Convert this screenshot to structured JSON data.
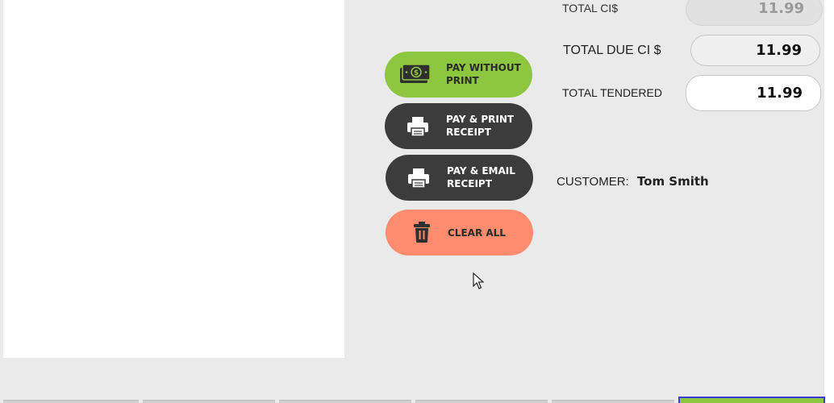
{
  "payment_buttons": {
    "pay_without_print": {
      "label": "PAY WITHOUT\nPRINT",
      "icon": "cash-icon"
    },
    "pay_print": {
      "label": "PAY & PRINT\nRECEIPT",
      "icon": "printer-icon"
    },
    "pay_email": {
      "label": "PAY & EMAIL\nRECEIPT",
      "icon": "printer-icon"
    },
    "clear_all": {
      "label": "CLEAR ALL",
      "icon": "trash-icon"
    }
  },
  "totals": {
    "total_ci": {
      "label": "TOTAL CI$",
      "value": "11.99"
    },
    "total_due": {
      "label": "TOTAL DUE CI $",
      "value": "11.99"
    },
    "total_tendered": {
      "label": "TOTAL TENDERED",
      "value": "11.99"
    }
  },
  "customer": {
    "label": "CUSTOMER:",
    "name": "Tom Smith"
  },
  "colors": {
    "pay_without_print_bg": "#8dc63f",
    "dark_button_bg": "#3c3c3c",
    "clear_all_bg": "#ff8c6e",
    "background": "#eaeaea"
  }
}
